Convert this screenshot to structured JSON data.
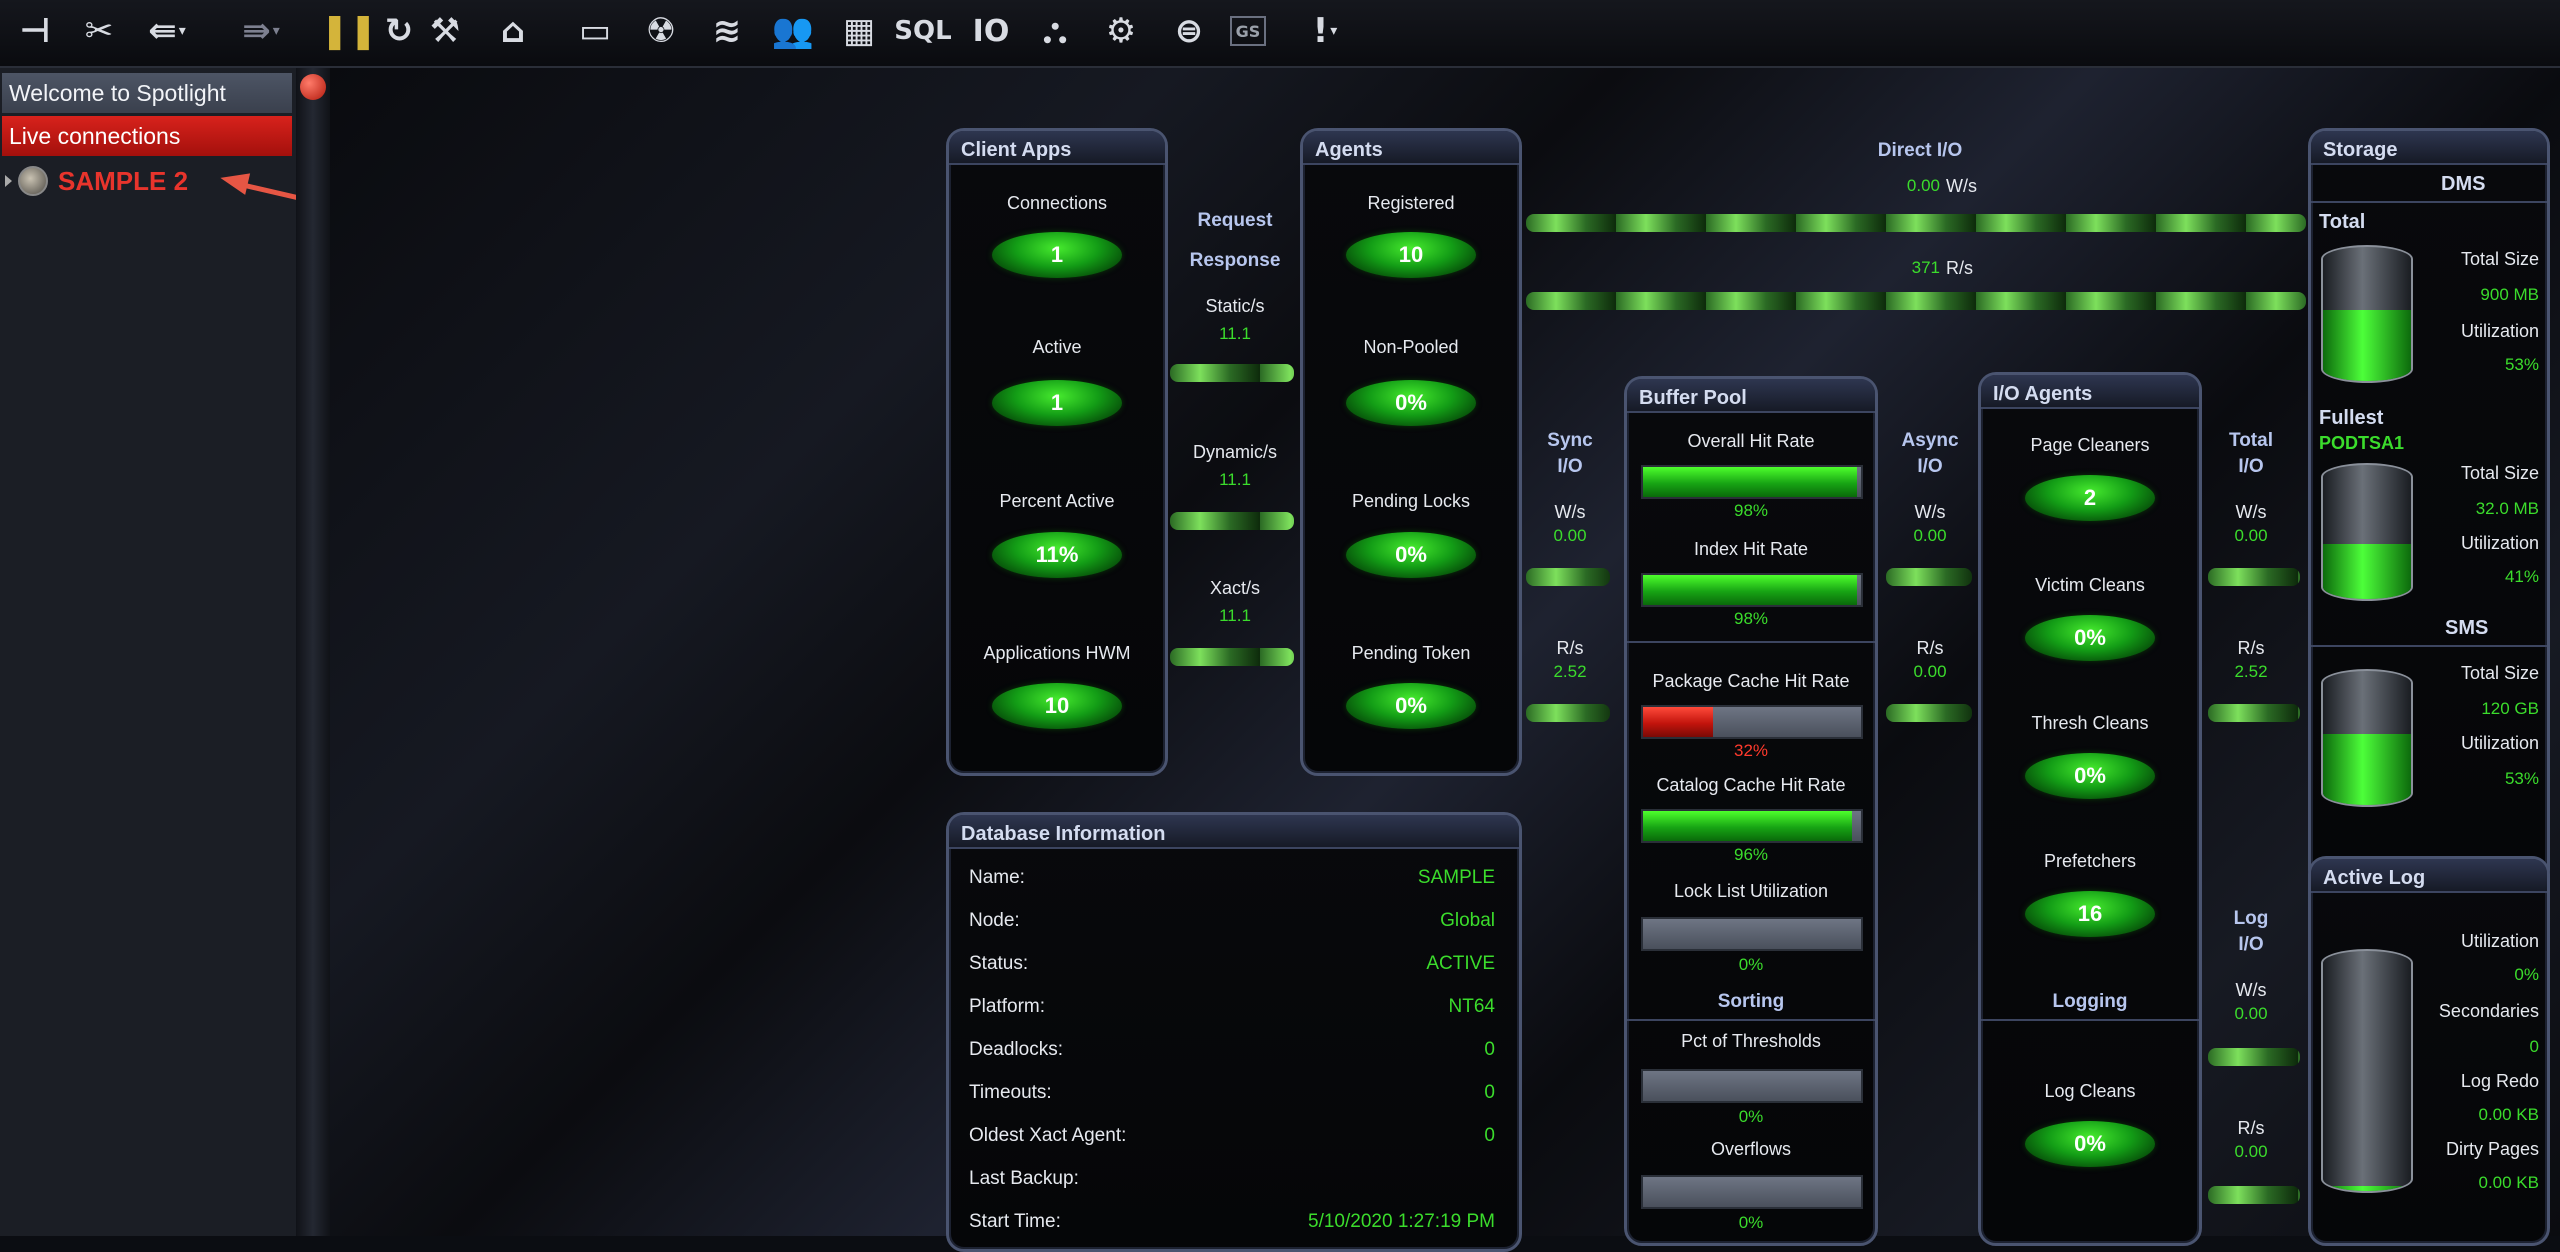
{
  "toolbar": {
    "icons": [
      "plug-icon",
      "unplug-icon",
      "back-icon",
      "forward-icon",
      "pause-icon",
      "refresh-icon",
      "tools-icon",
      "home-icon",
      "monitor-icon",
      "radiation-icon",
      "database-icon",
      "users-icon",
      "grid-icon",
      "sql-icon",
      "io-icon",
      "network-icon",
      "report-icon",
      "list-icon",
      "gs-icon",
      "alert-icon"
    ],
    "io_label": "IO",
    "sql_label": "SQL",
    "gs_label": "GS"
  },
  "sidebar": {
    "welcome": "Welcome to Spotlight",
    "live": "Live connections",
    "connection": "SAMPLE 2"
  },
  "client_apps": {
    "title": "Client Apps",
    "connections_label": "Connections",
    "connections": "1",
    "active_label": "Active",
    "active": "1",
    "percent_active_label": "Percent Active",
    "percent_active": "11%",
    "hwm_label": "Applications HWM",
    "hwm": "10"
  },
  "request": {
    "request_label": "Request",
    "response_label": "Response",
    "static_label": "Static/s",
    "static": "11.1",
    "dynamic_label": "Dynamic/s",
    "dynamic": "11.1",
    "xact_label": "Xact/s",
    "xact": "11.1"
  },
  "agents": {
    "title": "Agents",
    "registered_label": "Registered",
    "registered": "10",
    "nonpooled_label": "Non-Pooled",
    "nonpooled": "0%",
    "locks_label": "Pending Locks",
    "locks": "0%",
    "token_label": "Pending Token",
    "token": "0%"
  },
  "direct_io": {
    "title": "Direct I/O",
    "ws_value": "0.00",
    "ws_unit": "W/s",
    "rs_value": "371",
    "rs_unit": "R/s"
  },
  "sync_io": {
    "title_1": "Sync",
    "title_2": "I/O",
    "ws_unit": "W/s",
    "ws": "0.00",
    "rs_unit": "R/s",
    "rs": "2.52"
  },
  "buffer_pool": {
    "title": "Buffer Pool",
    "overall_label": "Overall Hit Rate",
    "overall": "98%",
    "overall_frac": 0.98,
    "index_label": "Index Hit Rate",
    "index": "98%",
    "index_frac": 0.98,
    "package_label": "Package Cache Hit Rate",
    "package": "32%",
    "package_frac": 0.32,
    "catalog_label": "Catalog Cache Hit Rate",
    "catalog": "96%",
    "catalog_frac": 0.96,
    "locklist_label": "Lock List Utilization",
    "locklist": "0%",
    "locklist_frac": 0,
    "sorting_title": "Sorting",
    "thresholds_label": "Pct of Thresholds",
    "thresholds": "0%",
    "thresholds_frac": 0,
    "overflows_label": "Overflows",
    "overflows": "0%",
    "overflows_frac": 0
  },
  "async_io": {
    "title_1": "Async",
    "title_2": "I/O",
    "ws_unit": "W/s",
    "ws": "0.00",
    "rs_unit": "R/s",
    "rs": "0.00"
  },
  "io_agents": {
    "title": "I/O Agents",
    "page_label": "Page Cleaners",
    "page": "2",
    "victim_label": "Victim Cleans",
    "victim": "0%",
    "thresh_label": "Thresh Cleans",
    "thresh": "0%",
    "prefetch_label": "Prefetchers",
    "prefetch": "16",
    "logging_title": "Logging",
    "logcleans_label": "Log Cleans",
    "logcleans": "0%"
  },
  "total_io": {
    "title_1": "Total",
    "title_2": "I/O",
    "ws_unit": "W/s",
    "ws": "0.00",
    "rs_unit": "R/s",
    "rs": "2.52"
  },
  "log_io": {
    "title_1": "Log",
    "title_2": "I/O",
    "ws_unit": "W/s",
    "ws": "0.00",
    "rs_unit": "R/s",
    "rs": "0.00"
  },
  "storage": {
    "title": "Storage",
    "dms": "DMS",
    "total_label": "Total",
    "total_size_label": "Total Size",
    "total_size": "900 MB",
    "total_util_label": "Utilization",
    "total_util": "53%",
    "total_util_frac": 0.53,
    "fullest_label": "Fullest",
    "fullest_name": "PODTSA1",
    "fullest_size_label": "Total Size",
    "fullest_size": "32.0 MB",
    "fullest_util_label": "Utilization",
    "fullest_util": "41%",
    "fullest_util_frac": 0.41,
    "sms": "SMS",
    "sms_size_label": "Total Size",
    "sms_size": "120 GB",
    "sms_util_label": "Utilization",
    "sms_util": "53%",
    "sms_util_frac": 0.53
  },
  "active_log": {
    "title": "Active Log",
    "util_label": "Utilization",
    "util": "0%",
    "util_frac": 0.02,
    "secondaries_label": "Secondaries",
    "secondaries": "0",
    "redo_label": "Log Redo",
    "redo": "0.00 KB",
    "dirty_label": "Dirty Pages",
    "dirty": "0.00 KB"
  },
  "db_info": {
    "title": "Database Information",
    "rows": [
      {
        "k": "Name:",
        "v": "SAMPLE"
      },
      {
        "k": "Node:",
        "v": "Global"
      },
      {
        "k": "Status:",
        "v": "ACTIVE"
      },
      {
        "k": "Platform:",
        "v": "NT64"
      },
      {
        "k": "Deadlocks:",
        "v": "0"
      },
      {
        "k": "Timeouts:",
        "v": "0"
      },
      {
        "k": "Oldest Xact Agent:",
        "v": "0"
      },
      {
        "k": "Last Backup:",
        "v": ""
      },
      {
        "k": "Start Time:",
        "v": "5/10/2020 1:27:19 PM"
      }
    ]
  },
  "colors": {
    "accent_green": "#3bdc2c",
    "alert_red": "#e8342c",
    "panel_border": "#4a5470"
  }
}
